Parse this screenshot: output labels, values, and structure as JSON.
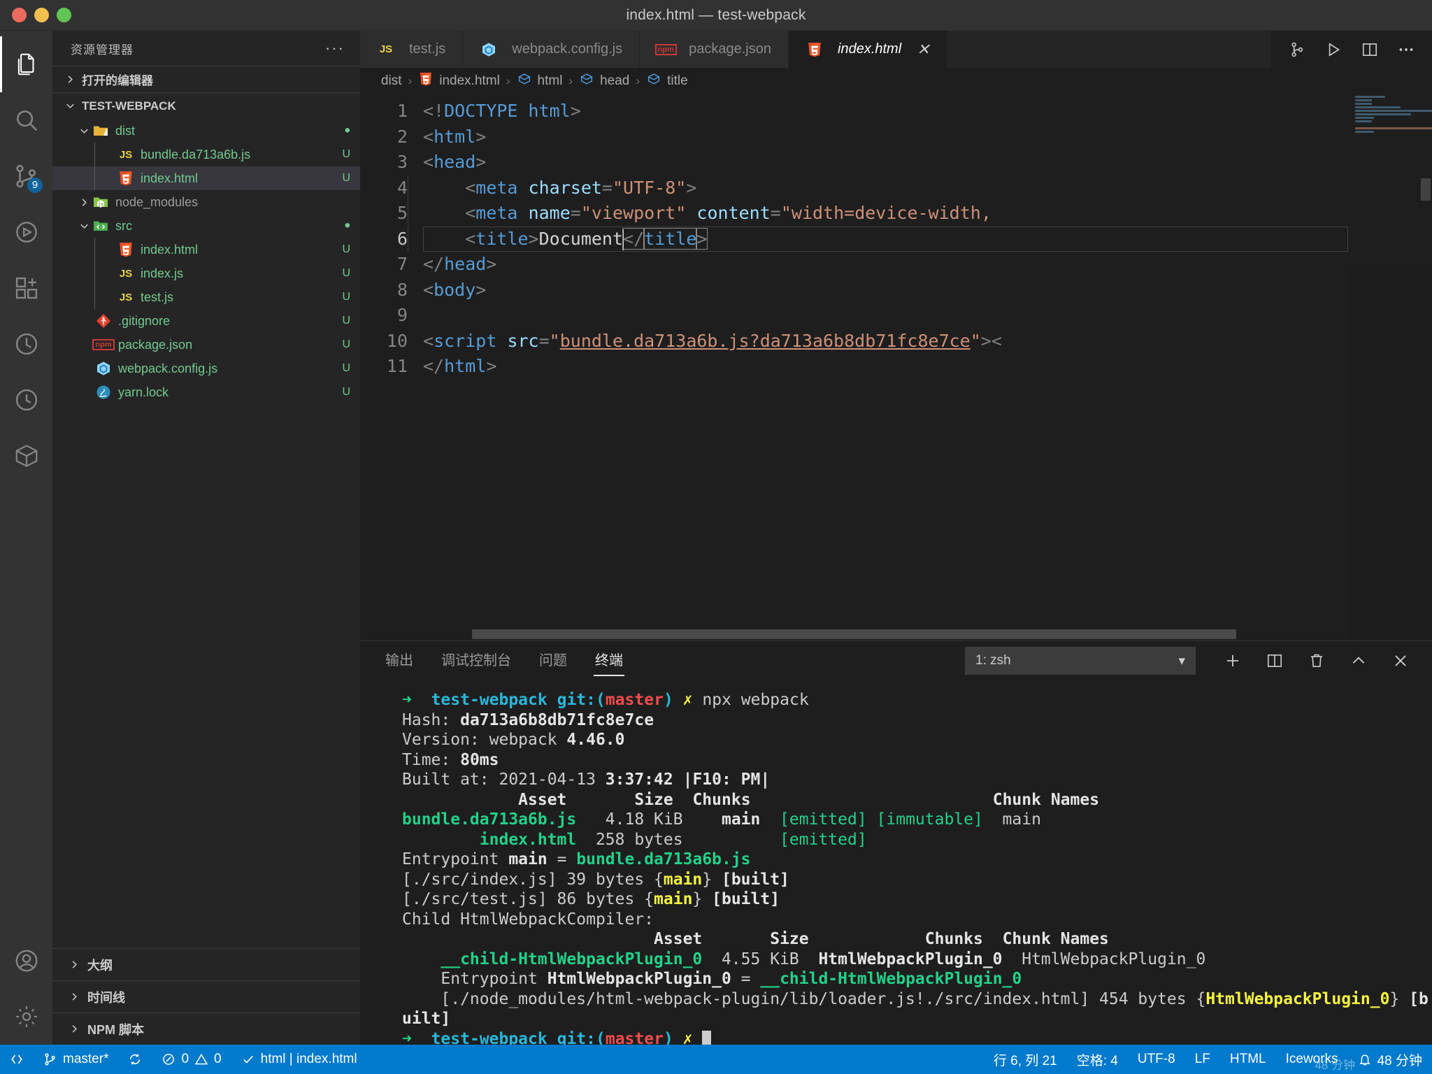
{
  "window": {
    "title": "index.html — test-webpack",
    "traffic_lights": [
      "close",
      "minimize",
      "zoom"
    ]
  },
  "activitybar": {
    "items": [
      {
        "name": "explorer",
        "icon": "files-icon",
        "active": true,
        "badge": null
      },
      {
        "name": "search",
        "icon": "search-icon",
        "active": false,
        "badge": null
      },
      {
        "name": "source-control",
        "icon": "source-control-icon",
        "active": false,
        "badge": "9"
      },
      {
        "name": "run-and-debug",
        "icon": "debug-icon",
        "active": false,
        "badge": null
      },
      {
        "name": "extensions",
        "icon": "extensions-icon",
        "active": false,
        "badge": null
      },
      {
        "name": "testing",
        "icon": "beaker-icon",
        "active": false,
        "badge": null
      },
      {
        "name": "timeline",
        "icon": "clock-icon",
        "active": false,
        "badge": null
      },
      {
        "name": "remote",
        "icon": "cube-icon",
        "active": false,
        "badge": null
      },
      {
        "name": "accounts",
        "icon": "account-icon",
        "active": false,
        "badge": null
      },
      {
        "name": "settings",
        "icon": "gear-icon",
        "active": false,
        "badge": null
      }
    ]
  },
  "sidebar": {
    "header_title": "资源管理器",
    "more_actions": "···",
    "open_editors_label": "打开的编辑器",
    "project_label": "TEST-WEBPACK",
    "tree": [
      {
        "label": "dist",
        "type": "folder",
        "icon": "folder-dist-icon",
        "depth": 1,
        "expanded": true,
        "status": "",
        "dot": true,
        "selected": false
      },
      {
        "label": "bundle.da713a6b.js",
        "type": "file",
        "icon": "js-icon",
        "depth": 2,
        "status": "U",
        "selected": false
      },
      {
        "label": "index.html",
        "type": "file",
        "icon": "html5-icon",
        "depth": 2,
        "status": "U",
        "selected": true
      },
      {
        "label": "node_modules",
        "type": "folder",
        "icon": "folder-node-icon",
        "depth": 1,
        "expanded": false,
        "status": "",
        "muted": true,
        "selected": false
      },
      {
        "label": "src",
        "type": "folder",
        "icon": "folder-src-icon",
        "depth": 1,
        "expanded": true,
        "status": "",
        "dot": true,
        "selected": false
      },
      {
        "label": "index.html",
        "type": "file",
        "icon": "html5-icon",
        "depth": 2,
        "status": "U",
        "selected": false
      },
      {
        "label": "index.js",
        "type": "file",
        "icon": "js-icon",
        "depth": 2,
        "status": "U",
        "selected": false
      },
      {
        "label": "test.js",
        "type": "file",
        "icon": "js-icon",
        "depth": 2,
        "status": "U",
        "selected": false
      },
      {
        "label": ".gitignore",
        "type": "file",
        "icon": "git-icon",
        "depth": 1,
        "status": "U",
        "selected": false
      },
      {
        "label": "package.json",
        "type": "file",
        "icon": "npm-icon",
        "depth": 1,
        "status": "U",
        "selected": false
      },
      {
        "label": "webpack.config.js",
        "type": "file",
        "icon": "webpack-icon",
        "depth": 1,
        "status": "U",
        "selected": false
      },
      {
        "label": "yarn.lock",
        "type": "file",
        "icon": "yarn-icon",
        "depth": 1,
        "status": "U",
        "selected": false
      }
    ],
    "bottom_sections": [
      {
        "label": "大纲"
      },
      {
        "label": "时间线"
      },
      {
        "label": "NPM 脚本"
      }
    ]
  },
  "editor": {
    "tabs": [
      {
        "label": "test.js",
        "icon": "js-icon",
        "active": false,
        "preview": false,
        "dirty": false
      },
      {
        "label": "webpack.config.js",
        "icon": "webpack-icon",
        "active": false,
        "preview": false,
        "dirty": false
      },
      {
        "label": "package.json",
        "icon": "npm-icon",
        "active": false,
        "preview": false,
        "dirty": false
      },
      {
        "label": "index.html",
        "icon": "html5-icon",
        "active": true,
        "preview": true,
        "dirty": false
      }
    ],
    "tab_close_label": "✕",
    "tab_actions": [
      {
        "name": "split-compare-icon"
      },
      {
        "name": "run-play-icon"
      },
      {
        "name": "split-editor-icon"
      },
      {
        "name": "more-actions-icon"
      }
    ],
    "breadcrumbs": [
      {
        "label": "dist",
        "icon": null
      },
      {
        "label": "index.html",
        "icon": "html5-icon"
      },
      {
        "label": "html",
        "icon": "symbol-field-icon"
      },
      {
        "label": "head",
        "icon": "symbol-field-icon"
      },
      {
        "label": "title",
        "icon": "symbol-field-icon"
      }
    ],
    "breadcrumb_separator": "›",
    "lines": [
      {
        "num": "1",
        "html": "<span class=\"ang\">&lt;!</span><span class=\"tag\">DOCTYPE html</span><span class=\"ang\">&gt;</span>"
      },
      {
        "num": "2",
        "html": "<span class=\"ang\">&lt;</span><span class=\"tag\">html</span><span class=\"ang\">&gt;</span>"
      },
      {
        "num": "3",
        "html": "<span class=\"ang\">&lt;</span><span class=\"tag\">head</span><span class=\"ang\">&gt;</span>"
      },
      {
        "num": "4",
        "html": "<span class=\"ig\"></span>    <span class=\"ang\">&lt;</span><span class=\"tag\">meta</span> <span class=\"attr\">charset</span><span class=\"ang\">=</span><span class=\"str\">\"UTF-8\"</span><span class=\"ang\">&gt;</span>"
      },
      {
        "num": "5",
        "html": "<span class=\"ig\"></span>    <span class=\"ang\">&lt;</span><span class=\"tag\">meta</span> <span class=\"attr\">name</span><span class=\"ang\">=</span><span class=\"str\">\"viewport\"</span> <span class=\"attr\">content</span><span class=\"ang\">=</span><span class=\"str\">\"width=device-width,</span>"
      },
      {
        "num": "6",
        "html": "<span class=\"ig\"></span>    <span class=\"ang\">&lt;</span><span class=\"tag\">title</span><span class=\"ang\">&gt;</span><span class=\"txt\">Document</span><span class=\"caret\"></span><span class=\"bracket-hl ang\">&lt;/</span><span class=\"bracket-hl tag\">title</span><span class=\"bracket-hl ang\">&gt;</span>",
        "current": true
      },
      {
        "num": "7",
        "html": "<span class=\"ang\">&lt;/</span><span class=\"tag\">head</span><span class=\"ang\">&gt;</span>"
      },
      {
        "num": "8",
        "html": "<span class=\"ang\">&lt;</span><span class=\"tag\">body</span><span class=\"ang\">&gt;</span>"
      },
      {
        "num": "9",
        "html": ""
      },
      {
        "num": "10",
        "html": "<span class=\"ang\">&lt;</span><span class=\"tag\">script</span> <span class=\"attr\">src</span><span class=\"ang\">=</span><span class=\"str\">\"</span><span class=\"str underline-link\">bundle.da713a6b.js?da713a6b8db71fc8e7ce</span><span class=\"str\">\"</span><span class=\"ang\">&gt;&lt;</span>"
      },
      {
        "num": "11",
        "html": "<span class=\"ang\">&lt;/</span><span class=\"tag\">html</span><span class=\"ang\">&gt;</span>"
      }
    ]
  },
  "panel": {
    "tabs": [
      {
        "label": "输出",
        "active": false
      },
      {
        "label": "调试控制台",
        "active": false
      },
      {
        "label": "问题",
        "active": false
      },
      {
        "label": "终端",
        "active": true
      }
    ],
    "terminal_select_value": "1: zsh",
    "terminal_select_caret": "▾",
    "actions": [
      {
        "name": "new-terminal-icon",
        "glyph": "+"
      },
      {
        "name": "split-terminal-icon"
      },
      {
        "name": "kill-terminal-icon"
      },
      {
        "name": "maximize-panel-icon"
      },
      {
        "name": "close-panel-icon"
      }
    ],
    "terminal_lines": [
      "<span class=\"g b\">➜</span>  <span class=\"c b\">test-webpack</span> <span class=\"c b\">git:(</span><span class=\"r b\">master</span><span class=\"c b\">)</span> <span class=\"y b\">✗</span> npx webpack",
      "Hash: <span class=\"b w\">da713a6b8db71fc8e7ce</span>",
      "Version: webpack <span class=\"b w\">4.46.0</span>",
      "Time: <span class=\"b w\">80ms</span>",
      "Built at: 2021-04-13 <span class=\"b w\">3:37:42</span> <span class=\"b w\">|F10: PM|</span>",
      "            <span class=\"b w\">Asset</span>       <span class=\"b w\">Size</span>  <span class=\"b w\">Chunks</span>                         <span class=\"b w\">Chunk Names</span>",
      "<span class=\"g b\">bundle.da713a6b.js</span>   4.18 KiB    <span class=\"b w\">main</span>  <span class=\"g\">[emitted] [immutable]</span>  main",
      "        <span class=\"g b\">index.html</span>  258 bytes          <span class=\"g\">[emitted]</span>",
      "Entrypoint <span class=\"b w\">main</span> = <span class=\"g b\">bundle.da713a6b.js</span>",
      "[./src/index.js] 39 bytes {<span class=\"y b\">main</span>} <span class=\"b w\">[built]</span>",
      "[./src/test.js] 86 bytes {<span class=\"y b\">main</span>} <span class=\"b w\">[built]</span>",
      "Child HtmlWebpackCompiler:",
      "                          <span class=\"b w\">Asset</span>       <span class=\"b w\">Size</span>            <span class=\"b w\">Chunks</span>  <span class=\"b w\">Chunk Names</span>",
      "    <span class=\"g b\">__child-HtmlWebpackPlugin_0</span>  4.55 KiB  <span class=\"b w\">HtmlWebpackPlugin_0</span>  HtmlWebpackPlugin_0",
      "    Entrypoint <span class=\"b w\">HtmlWebpackPlugin_0</span> = <span class=\"g b\">__child-HtmlWebpackPlugin_0</span>",
      "    [./node_modules/html-webpack-plugin/lib/loader.js!./src/index.html] 454 bytes {<span class=\"y b\">HtmlWebpackPlugin_0</span>} <span class=\"b w\">[built]</span>",
      "<span class=\"g b\">➜</span>  <span class=\"c b\">test-webpack</span> <span class=\"c b\">git:(</span><span class=\"r b\">master</span><span class=\"c b\">)</span> <span class=\"y b\">✗</span> <span class=\"blk\"></span>"
    ]
  },
  "statusbar": {
    "left": [
      {
        "name": "remote-indicator",
        "icon": "remote-icon",
        "label": ""
      },
      {
        "name": "branch",
        "icon": "source-control-icon",
        "label": "master*"
      },
      {
        "name": "sync",
        "icon": "sync-icon",
        "label": ""
      },
      {
        "name": "problems",
        "icon": "error-warning-icon",
        "label": "0  0",
        "errors": "0",
        "warnings": "0"
      },
      {
        "name": "tasks",
        "icon": "check-icon",
        "label": "html | index.html"
      }
    ],
    "right": [
      {
        "name": "cursor-position",
        "label": "行 6, 列 21"
      },
      {
        "name": "indentation",
        "label": "空格: 4"
      },
      {
        "name": "encoding",
        "label": "UTF-8"
      },
      {
        "name": "eol",
        "label": "LF"
      },
      {
        "name": "language-mode",
        "label": "HTML"
      },
      {
        "name": "iceworks",
        "label": "Iceworks"
      },
      {
        "name": "notifications",
        "icon": "bell-icon",
        "label": "48 分钟"
      }
    ],
    "accent_color": "#007acc",
    "watermark": "48 分钟"
  }
}
